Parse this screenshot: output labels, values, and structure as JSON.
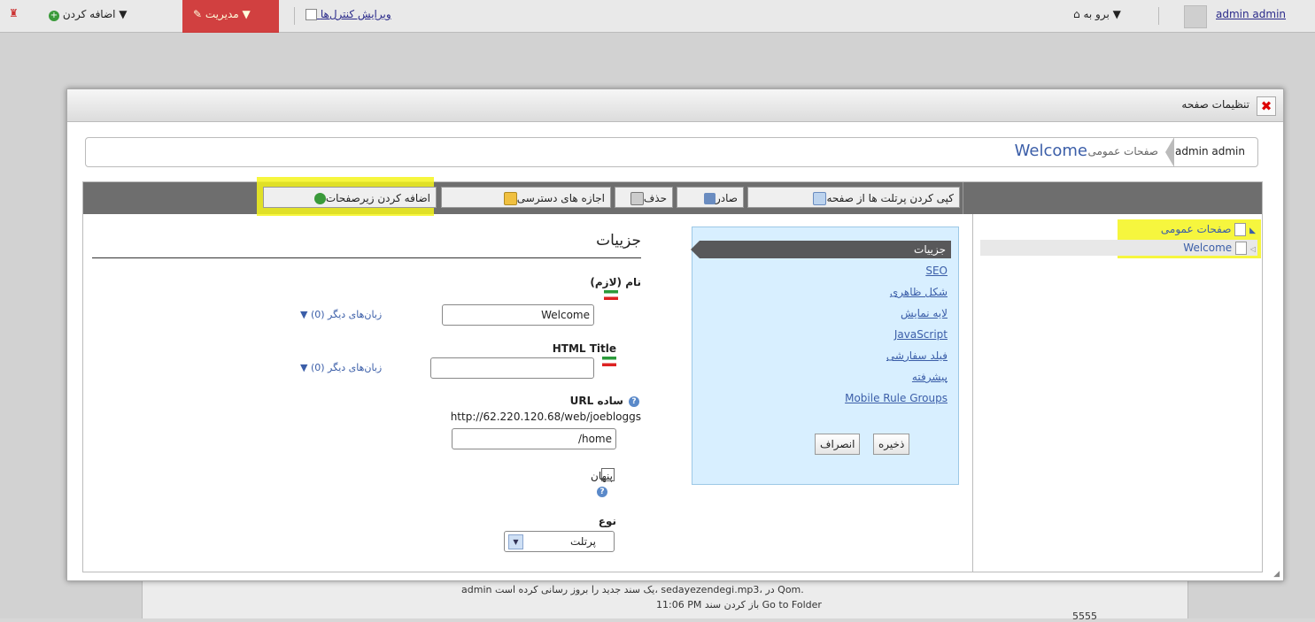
{
  "topbar": {
    "user": "admin admin",
    "go_to": "برو به",
    "edit_controls": "ویرایش کنترل‌ها",
    "manage": "مدیریت",
    "add": "اضافه کردن"
  },
  "background": {
    "line1": "admin یک سند جدید را بروز رسانی کرده است، sedayezendegi.mp3، در Qom.",
    "line2": "11:06 PM باز کردن سند Go to Folder",
    "number": "5555"
  },
  "dialog": {
    "title": "تنظیمات صفحه",
    "breadcrumb": [
      "admin admin",
      "صفحات عمومی",
      "Welcome"
    ],
    "toolbar": {
      "copy_portlets": "کپی کردن پرتلت ها از صفحه",
      "export": "صادر",
      "delete": "حذف",
      "permissions": "اجازه های دسترسی",
      "add_child_page": "اضافه کردن زیرصفحات"
    },
    "tree": {
      "root": "صفحات عمومی",
      "child": "Welcome"
    },
    "menu": {
      "items": [
        "جزییات",
        "SEO",
        "شکل ظاهری",
        "لایه نمایش",
        "JavaScript",
        "فیلد سفارشی",
        "پیشرفته",
        "Mobile Rule Groups"
      ],
      "save": "ذخیره",
      "cancel": "انصراف"
    },
    "form": {
      "heading": "جزییات",
      "name_label": "نام (لازم)",
      "name_value": "Welcome",
      "other_langs": "زبان‌های دیگر (0)",
      "html_title_label": "HTML Title",
      "html_title_value": "",
      "friendly_url_label": "URL ساده",
      "url_prefix": "http://62.220.120.68/web/joebloggs",
      "url_value": "/home",
      "hidden_label": "پنهان",
      "type_label": "نوع",
      "type_value": "پرتلت"
    }
  }
}
